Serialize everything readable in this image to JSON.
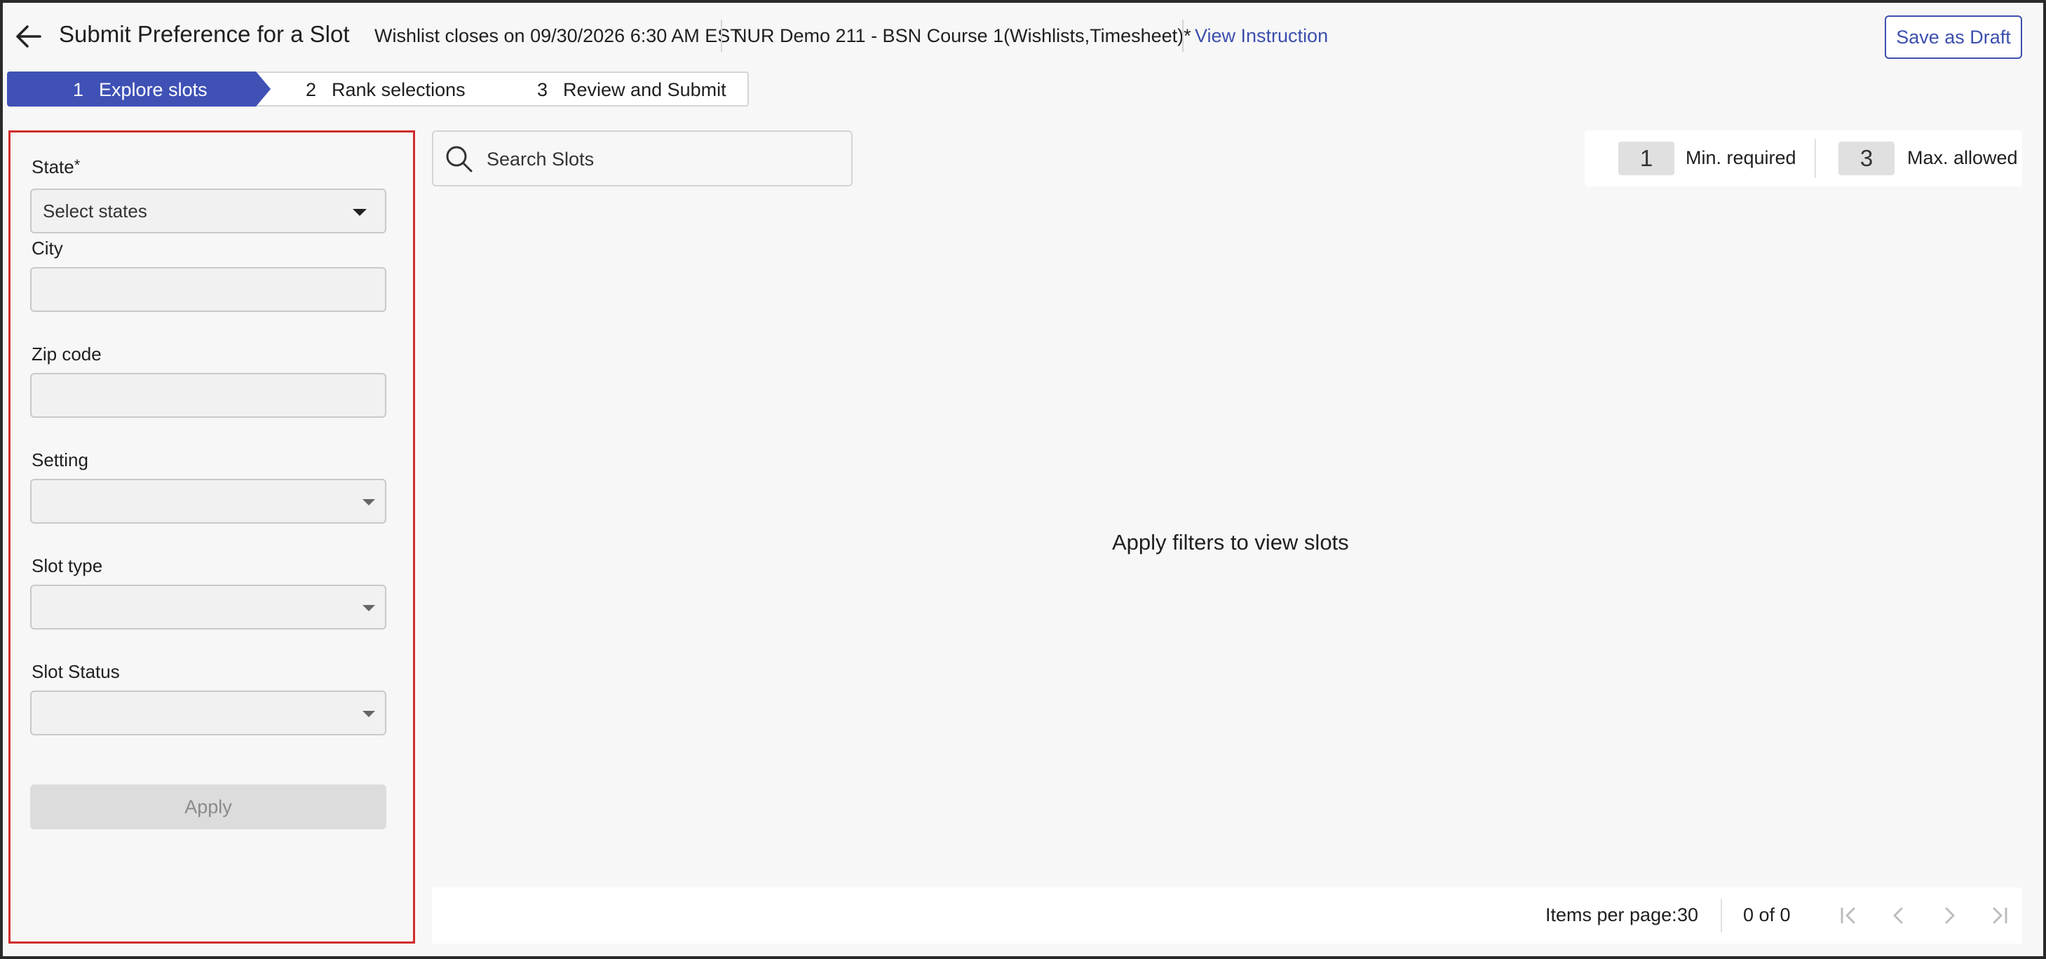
{
  "header": {
    "title": "Submit Preference for a Slot",
    "wishlist_closes": "Wishlist closes on 09/30/2026 6:30 AM EST",
    "course": "NUR Demo 211 - BSN Course 1(Wishlists,Timesheet)*",
    "view_instruction": "View Instruction",
    "save_draft": "Save as Draft"
  },
  "stepper": {
    "steps": [
      {
        "num": "1",
        "label": "Explore slots"
      },
      {
        "num": "2",
        "label": "Rank selections"
      },
      {
        "num": "3",
        "label": "Review and Submit"
      }
    ]
  },
  "filters": {
    "state_label": "State",
    "required_mark": "*",
    "state_placeholder": "Select states",
    "city_label": "City",
    "zip_label": "Zip code",
    "setting_label": "Setting",
    "slot_type_label": "Slot type",
    "slot_status_label": "Slot Status",
    "apply_label": "Apply"
  },
  "search": {
    "placeholder": "Search Slots"
  },
  "counters": {
    "min_value": "1",
    "min_label": "Min. required",
    "max_value": "3",
    "max_label": "Max. allowed"
  },
  "main": {
    "empty_message": "Apply filters to view slots"
  },
  "pagination": {
    "items_per_page_label": "Items per page:",
    "items_per_page": "30",
    "range": "0 of 0"
  },
  "icons": {
    "back": "arrow-left-icon",
    "search": "search-icon",
    "first": "first-page-icon",
    "prev": "chevron-left-icon",
    "next": "chevron-right-icon",
    "last": "last-page-icon"
  },
  "colors": {
    "accent": "#3f51b5",
    "link": "#3c4fae",
    "highlight_border": "#d22c2c"
  }
}
